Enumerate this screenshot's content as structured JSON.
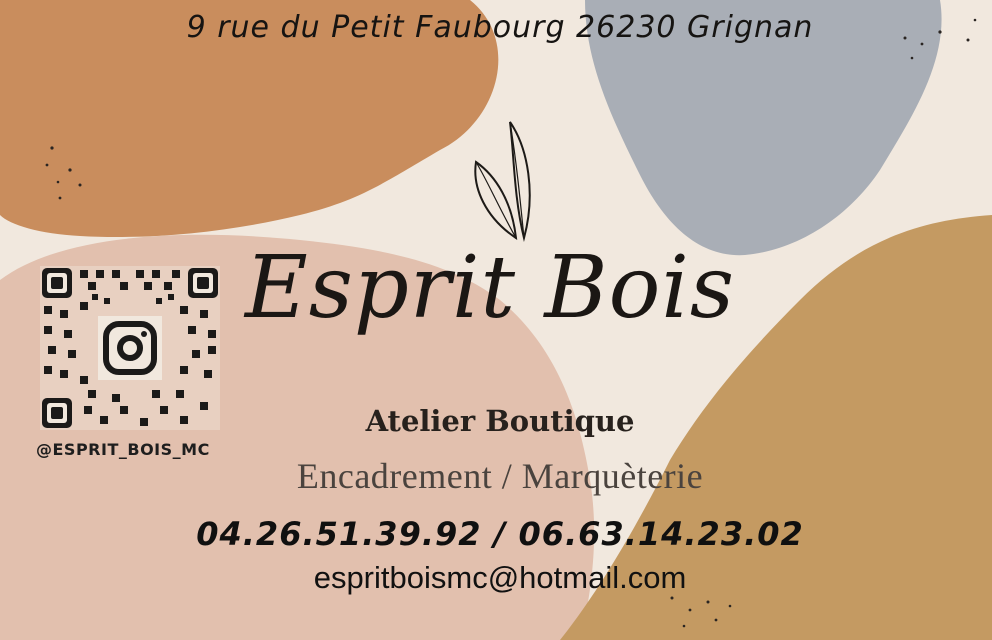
{
  "card": {
    "address": "9 rue du Petit Faubourg 26230 Grignan",
    "brand_name": "Esprit Bois",
    "tagline": "Atelier Boutique",
    "services": "Encadrement / Marquèterie",
    "phones": "04.26.51.39.92 / 06.63.14.23.02",
    "email": "espritboismc@hotmail.com",
    "social_handle": "@ESPRIT_BOIS_MC"
  },
  "icons": {
    "leaf": "leaf-icon",
    "qr": "qr-code-icon",
    "social": "instagram-icon"
  },
  "colors": {
    "background": "#f1e8de",
    "terracotta": "#c98d5d",
    "slate": "#a9aeb6",
    "blush": "#e2c0ae",
    "ochre": "#c49a62",
    "text": "#161412"
  }
}
